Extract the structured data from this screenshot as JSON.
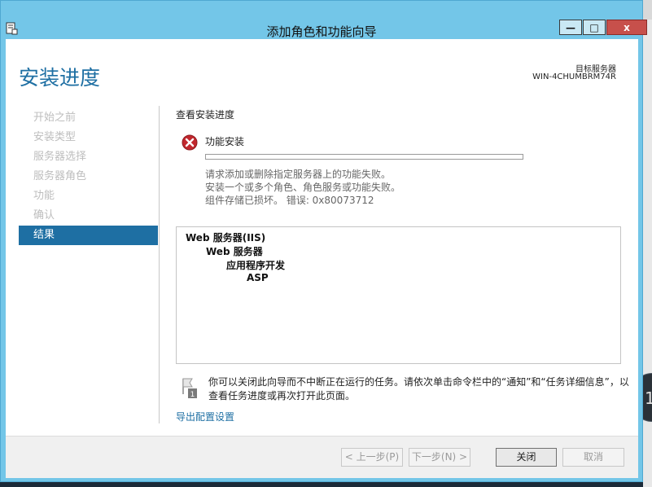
{
  "window": {
    "title": "添加角色和功能向导",
    "controls": {
      "minimize": "—",
      "maximize": "□",
      "close": "x"
    }
  },
  "header": {
    "page_title": "安装进度",
    "destination_label": "目标服务器",
    "destination_server": "WIN-4CHUMBRM74R"
  },
  "nav": {
    "items": [
      {
        "label": "开始之前",
        "active": false
      },
      {
        "label": "安装类型",
        "active": false
      },
      {
        "label": "服务器选择",
        "active": false
      },
      {
        "label": "服务器角色",
        "active": false
      },
      {
        "label": "功能",
        "active": false
      },
      {
        "label": "确认",
        "active": false
      },
      {
        "label": "结果",
        "active": true
      }
    ]
  },
  "main": {
    "section_heading": "查看安装进度",
    "status": {
      "icon": "error-icon",
      "title": "功能安装",
      "progress": 0,
      "messages": [
        "请求添加或删除指定服务器上的功能失败。",
        "安装一个或多个角色、角色服务或功能失败。",
        "组件存储已损坏。 错误: 0x80073712"
      ]
    },
    "features": [
      {
        "label": "Web 服务器(IIS)",
        "level": 0
      },
      {
        "label": "Web 服务器",
        "level": 1
      },
      {
        "label": "应用程序开发",
        "level": 2
      },
      {
        "label": "ASP",
        "level": 3
      }
    ],
    "note": {
      "icon": "flag-notification-icon",
      "text": "你可以关闭此向导而不中断正在运行的任务。请依次单击命令栏中的“通知”和“任务详细信息”，以查看任务进度或再次打开此页面。"
    },
    "export_link": "导出配置设置"
  },
  "footer": {
    "prev_label": "< 上一步(P)",
    "next_label": "下一步(N) >",
    "close_label": "关闭",
    "cancel_label": "取消"
  },
  "colors": {
    "accent": "#1e6fa3",
    "titlebar": "#73c6e8",
    "error": "#c1272d"
  }
}
